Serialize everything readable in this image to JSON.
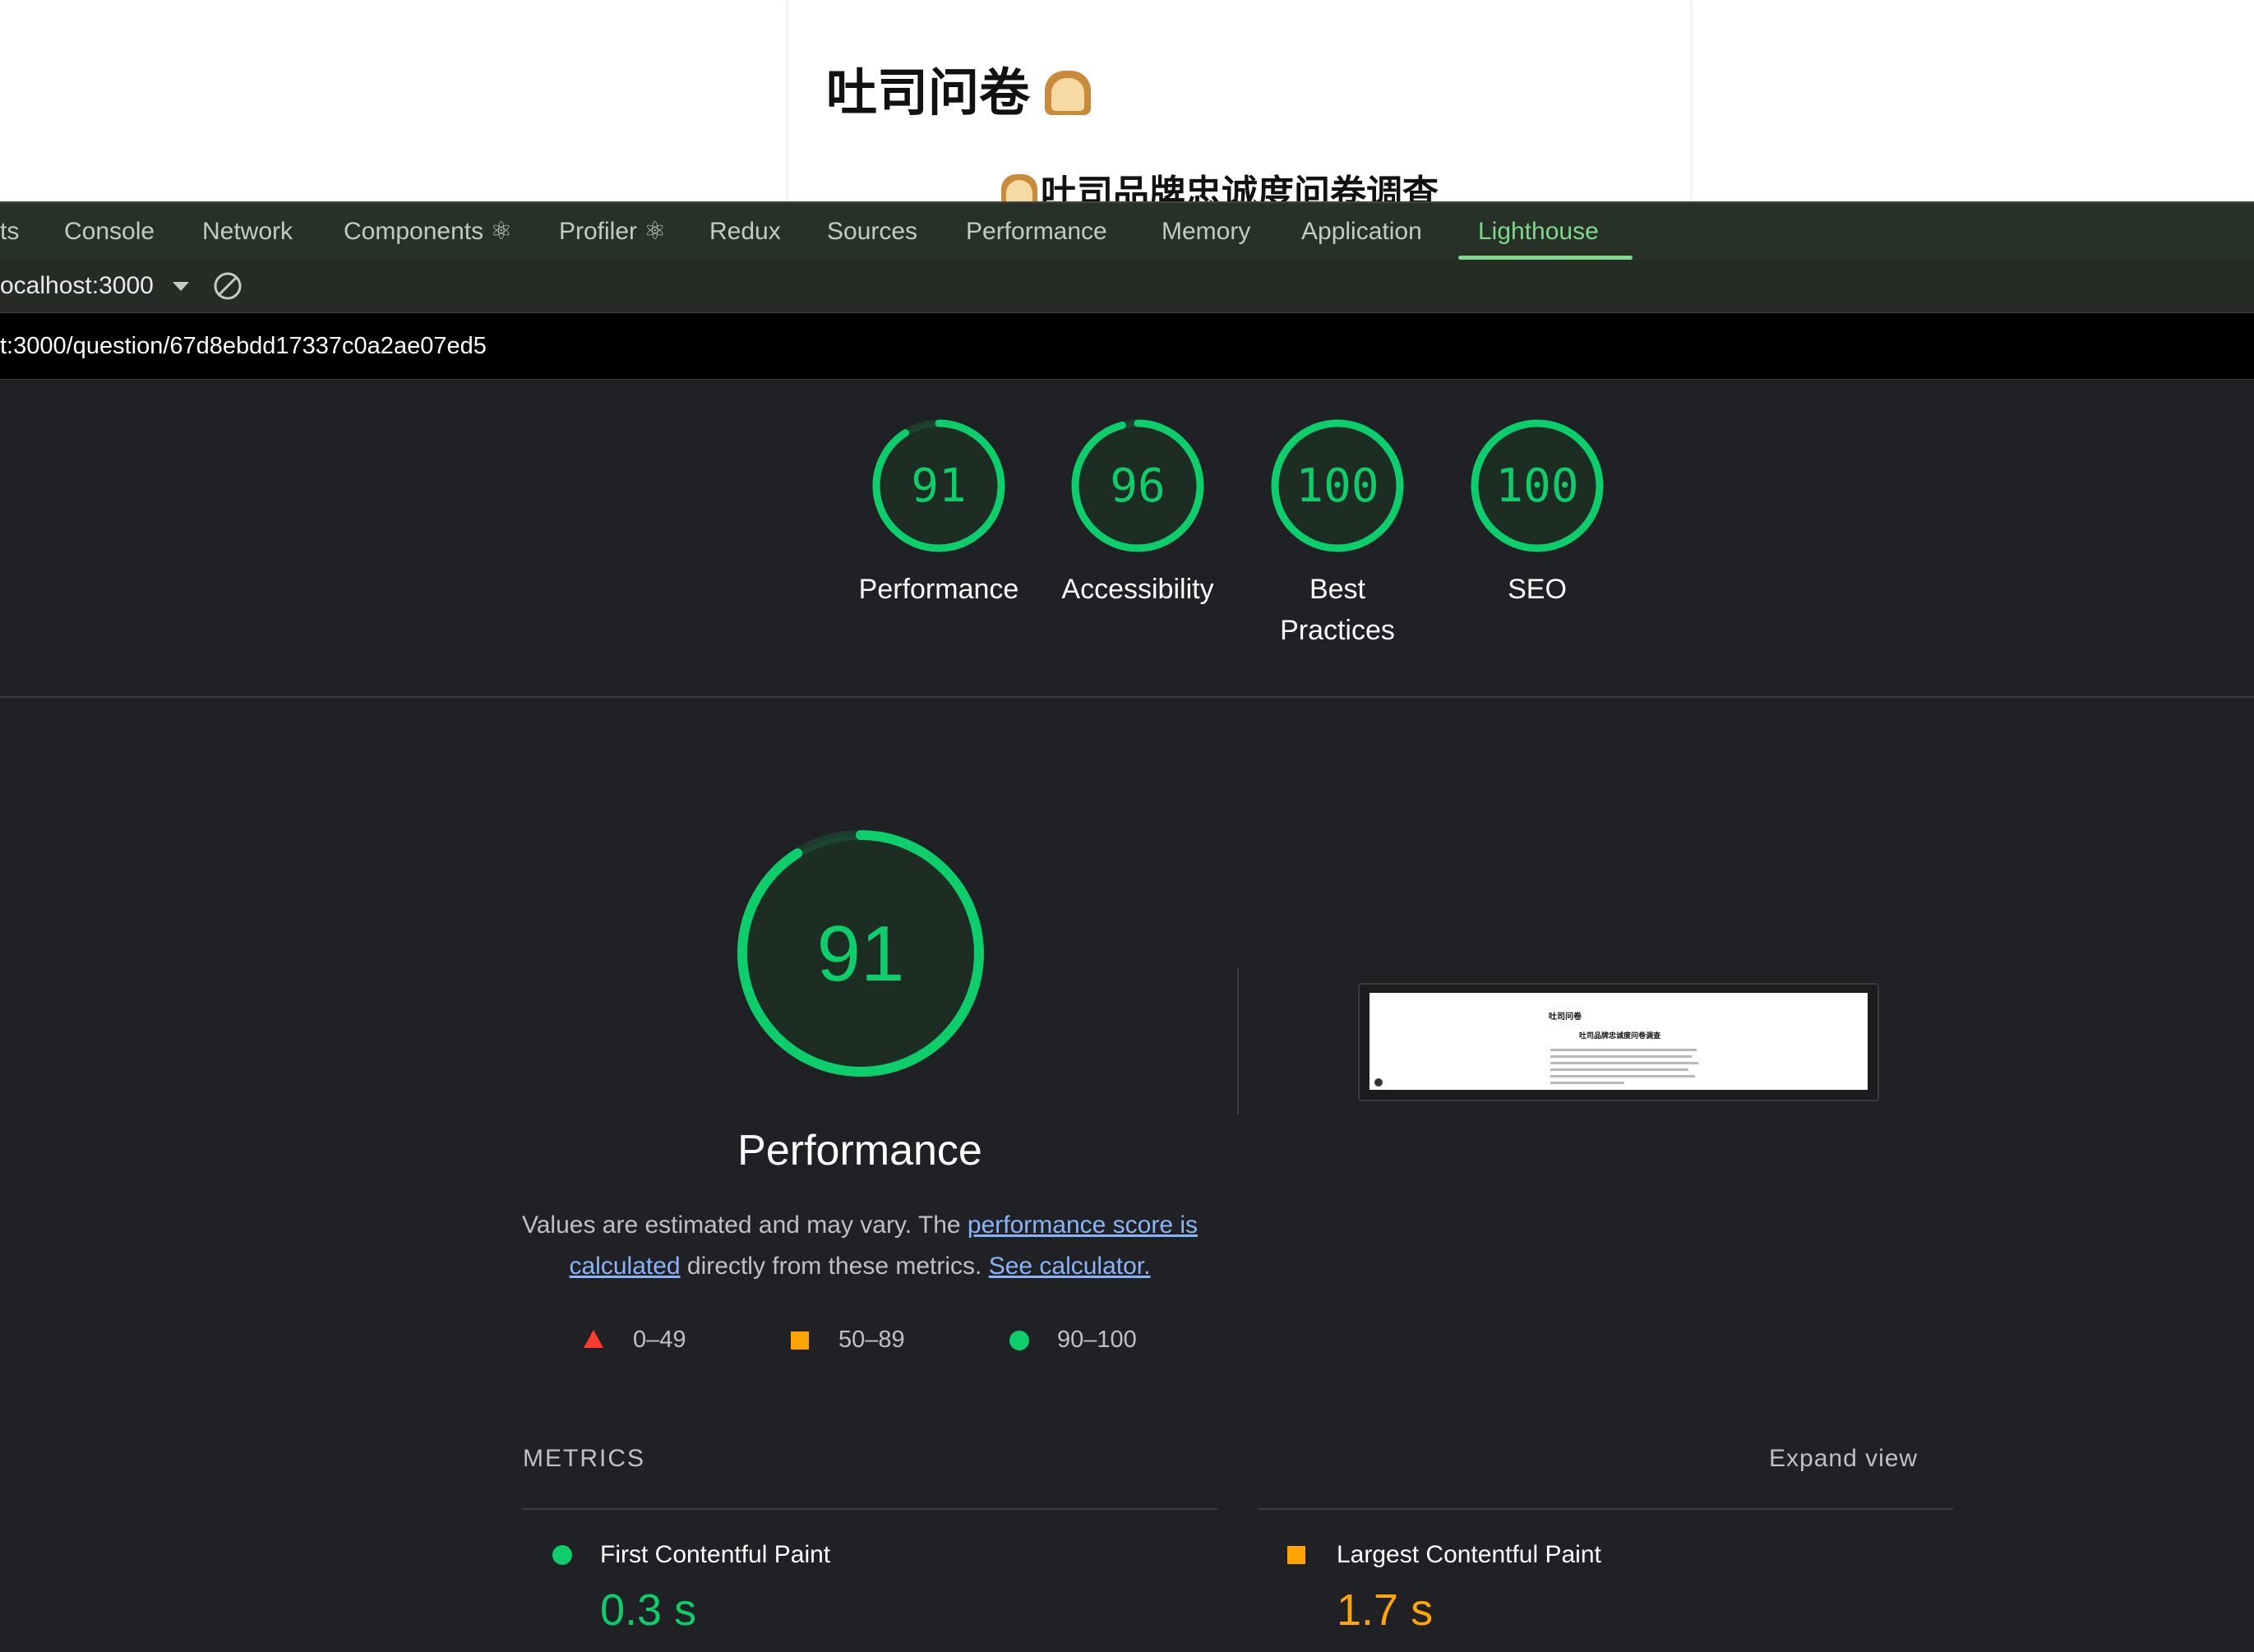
{
  "page": {
    "title": "吐司问卷",
    "subtitle": "吐司品牌忠诚度问卷调查"
  },
  "devtools": {
    "tabs": [
      {
        "label": "ts"
      },
      {
        "label": "Console"
      },
      {
        "label": "Network"
      },
      {
        "label": "Components ⚛"
      },
      {
        "label": "Profiler ⚛"
      },
      {
        "label": "Redux"
      },
      {
        "label": "Sources"
      },
      {
        "label": "Performance"
      },
      {
        "label": "Memory"
      },
      {
        "label": "Application"
      },
      {
        "label": "Lighthouse",
        "active": true
      }
    ],
    "origin": "ocalhost:3000",
    "url": "t:3000/question/67d8ebdd17337c0a2ae07ed5"
  },
  "scores": [
    {
      "value": 91,
      "label": "Performance",
      "label_lines": [
        "Performance"
      ]
    },
    {
      "value": 96,
      "label": "Accessibility",
      "label_lines": [
        "Accessibility"
      ]
    },
    {
      "value": 100,
      "label": "Best Practices",
      "label_lines": [
        "Best",
        "Practices"
      ]
    },
    {
      "value": 100,
      "label": "SEO",
      "label_lines": [
        "SEO"
      ]
    }
  ],
  "performance": {
    "score": 91,
    "title": "Performance",
    "desc_prefix": "Values are estimated and may vary. The ",
    "desc_link1": "performance score is calculated",
    "desc_middle": " directly from these metrics. ",
    "desc_link2": "See calculator.",
    "legend": [
      {
        "range": "0–49",
        "shape": "triangle",
        "color": "#ff3b30"
      },
      {
        "range": "50–89",
        "shape": "square",
        "color": "#ffa400"
      },
      {
        "range": "90–100",
        "shape": "circle",
        "color": "#0cce6b"
      }
    ],
    "thumbnail": {
      "title": "吐司问卷",
      "subtitle": "吐司品牌忠诚度问卷调查"
    }
  },
  "metrics": {
    "heading": "METRICS",
    "expand_label": "Expand view",
    "items": [
      {
        "name": "First Contentful Paint",
        "value": "0.3 s",
        "status": "pass",
        "color": "#0cce6b"
      },
      {
        "name": "Largest Contentful Paint",
        "value": "1.7 s",
        "status": "average",
        "color": "#ffa400"
      }
    ]
  },
  "colors": {
    "pass": "#0cce6b",
    "average": "#ffa400",
    "fail": "#ff3b30",
    "active_tab": "#7fd98d",
    "link": "#8ab4f8"
  }
}
